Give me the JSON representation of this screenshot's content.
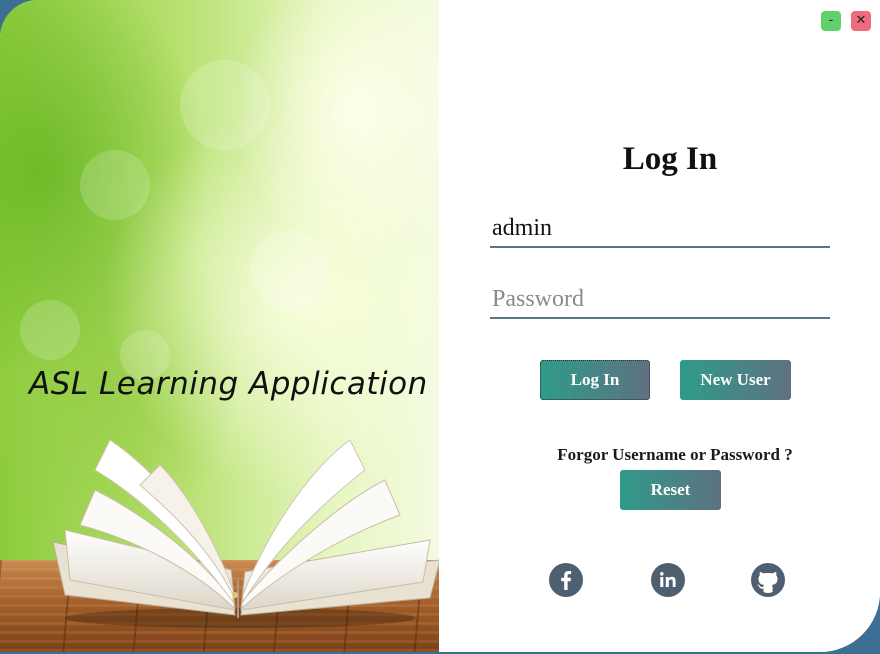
{
  "window": {
    "minimize_glyph": "-",
    "close_glyph": "✕",
    "minimize_color": "#5fd06c",
    "close_color": "#f06b7d"
  },
  "brand_panel": {
    "app_title": "ASL Learning Application"
  },
  "login_form": {
    "heading": "Log In",
    "username_value": "admin",
    "password_placeholder": "Password",
    "login_button": "Log In",
    "new_user_button": "New User",
    "forgot_text": "Forgor Username or Password ?",
    "reset_button": "Reset"
  },
  "social_links": [
    {
      "icon": "facebook-icon"
    },
    {
      "icon": "linkedin-icon"
    },
    {
      "icon": "github-icon"
    }
  ],
  "colors": {
    "button_gradient_start": "#2f9b89",
    "button_gradient_end": "#5e7182",
    "social_icon": "#4e5f70",
    "input_underline": "#5a7486"
  }
}
